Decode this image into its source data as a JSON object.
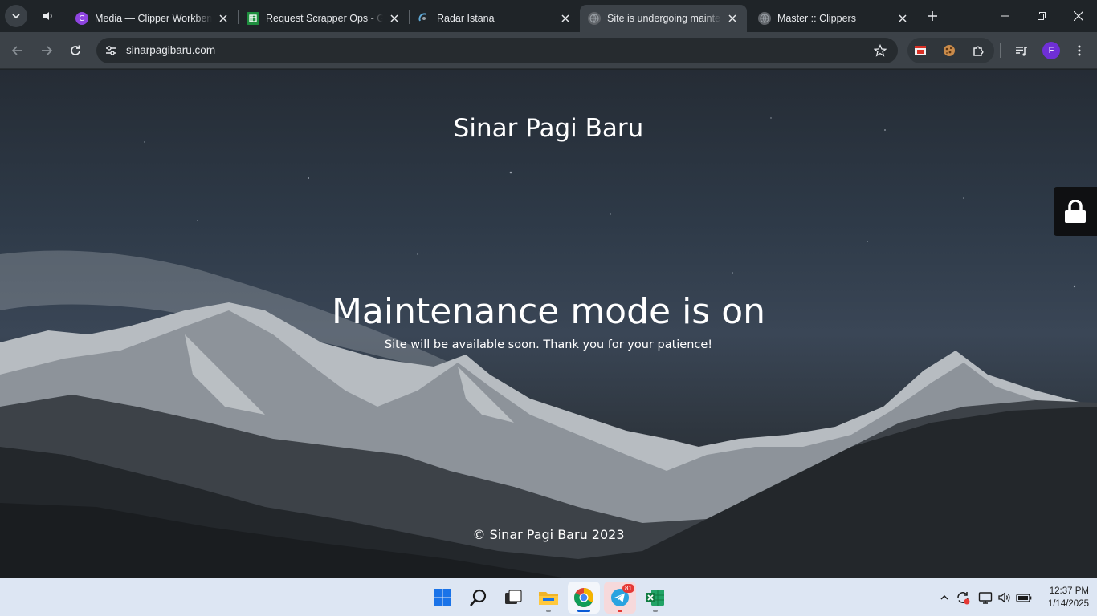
{
  "browser": {
    "tabs": [
      {
        "title": "Media — Clipper Workbench",
        "favicon": "clipper-letter-icon",
        "favicon_text": "C",
        "favicon_color": "#8e44e0",
        "active": false
      },
      {
        "title": "Request Scrapper Ops - Google Sheets",
        "favicon": "sheets-icon",
        "favicon_color": "#1e8e3e",
        "active": false
      },
      {
        "title": "Radar Istana",
        "favicon": "radar-icon",
        "active": false
      },
      {
        "title": "Site is undergoing maintenance",
        "favicon": "globe-icon",
        "active": true
      },
      {
        "title": "Master :: Clippers",
        "favicon": "globe-icon",
        "active": false
      }
    ],
    "address_bar": {
      "url": "sinarpagibaru.com"
    },
    "profile_initial": "F",
    "profile_color": "#6f2fd6"
  },
  "page": {
    "site_name": "Sinar Pagi Baru",
    "headline": "Maintenance mode is on",
    "subline": "Site will be available soon. Thank you for your patience!",
    "footer": "© Sinar Pagi Baru 2023"
  },
  "taskbar": {
    "apps": [
      "start-icon",
      "search-icon",
      "task-view-icon",
      "file-explorer-icon",
      "chrome-icon",
      "telegram-icon",
      "excel-icon"
    ],
    "telegram_badge": "81",
    "clock": {
      "time": "12:37 PM",
      "date": "1/14/2025"
    }
  }
}
